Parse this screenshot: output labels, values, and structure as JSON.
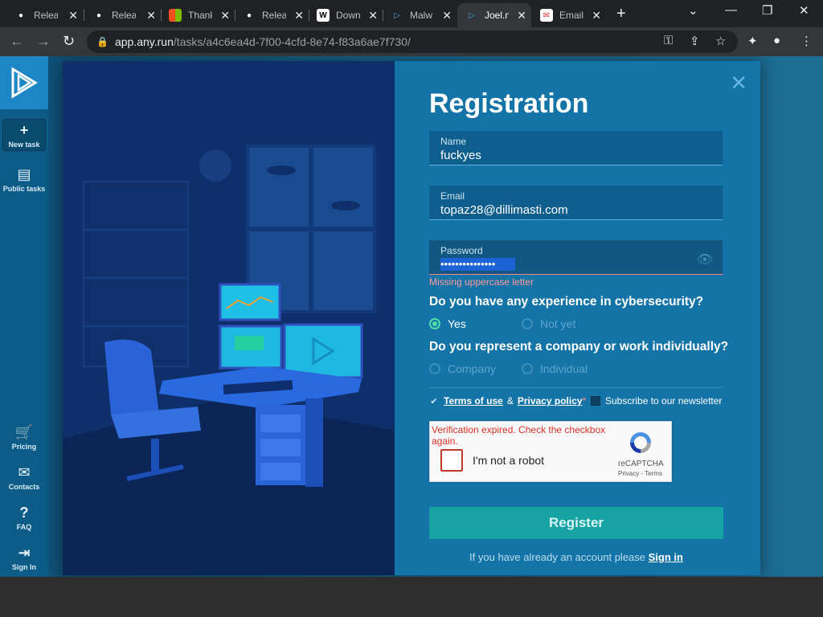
{
  "browser": {
    "tabs": [
      {
        "title": "Relea",
        "icon": "github-icon"
      },
      {
        "title": "Relea",
        "icon": "github-icon"
      },
      {
        "title": "Thank",
        "icon": "microsoft-icon"
      },
      {
        "title": "Relea",
        "icon": "github-icon"
      },
      {
        "title": "Down",
        "icon": "w-icon"
      },
      {
        "title": "Malw",
        "icon": "anyrun-icon"
      },
      {
        "title": "Joel.n",
        "icon": "anyrun-icon"
      },
      {
        "title": "Email",
        "icon": "email-icon"
      }
    ],
    "active_tab_index": 6,
    "url_host": "app.any.run",
    "url_path": "/tasks/a4c6ea4d-7f00-4cfd-8e74-f83a6ae7f730/"
  },
  "sidebar": {
    "items": [
      {
        "label": "New task",
        "icon": "plus-icon"
      },
      {
        "label": "Public tasks",
        "icon": "document-icon"
      },
      {
        "label": "Pricing",
        "icon": "cart-icon"
      },
      {
        "label": "Contacts",
        "icon": "mail-icon"
      },
      {
        "label": "FAQ",
        "icon": "help-icon"
      },
      {
        "label": "Sign In",
        "icon": "sign-in-icon"
      }
    ]
  },
  "form": {
    "title": "Registration",
    "name": {
      "label": "Name",
      "value": "fuckyes"
    },
    "email": {
      "label": "Email",
      "value": "topaz28@dillimasti.com"
    },
    "password": {
      "label": "Password",
      "value": "•••••••••••••••",
      "error": "Missing uppercase letter"
    },
    "q1": {
      "text": "Do you have any experience in cybersecurity?",
      "options": [
        "Yes",
        "Not yet"
      ],
      "selected": "Yes"
    },
    "q2": {
      "text": "Do you represent a company or work individually?",
      "options": [
        "Company",
        "Individual"
      ],
      "selected": null
    },
    "terms": {
      "terms_link": "Terms of use",
      "amp": "&",
      "privacy_link": "Privacy policy",
      "required_mark": "*",
      "checked": true
    },
    "newsletter": {
      "label": "Subscribe to our newsletter",
      "checked": false
    },
    "captcha": {
      "expired_msg": "Verification expired. Check the checkbox again.",
      "label": "I'm not a robot",
      "brand": "reCAPTCHA",
      "links": "Privacy - Terms"
    },
    "register_button": "Register",
    "signin_prompt": "If you have already an account please",
    "signin_link": "Sign in"
  },
  "colors": {
    "accent": "#17a2a4",
    "form_bg": "#1474a7",
    "error": "#ff9a9a",
    "radio_on": "#50e0a8"
  }
}
